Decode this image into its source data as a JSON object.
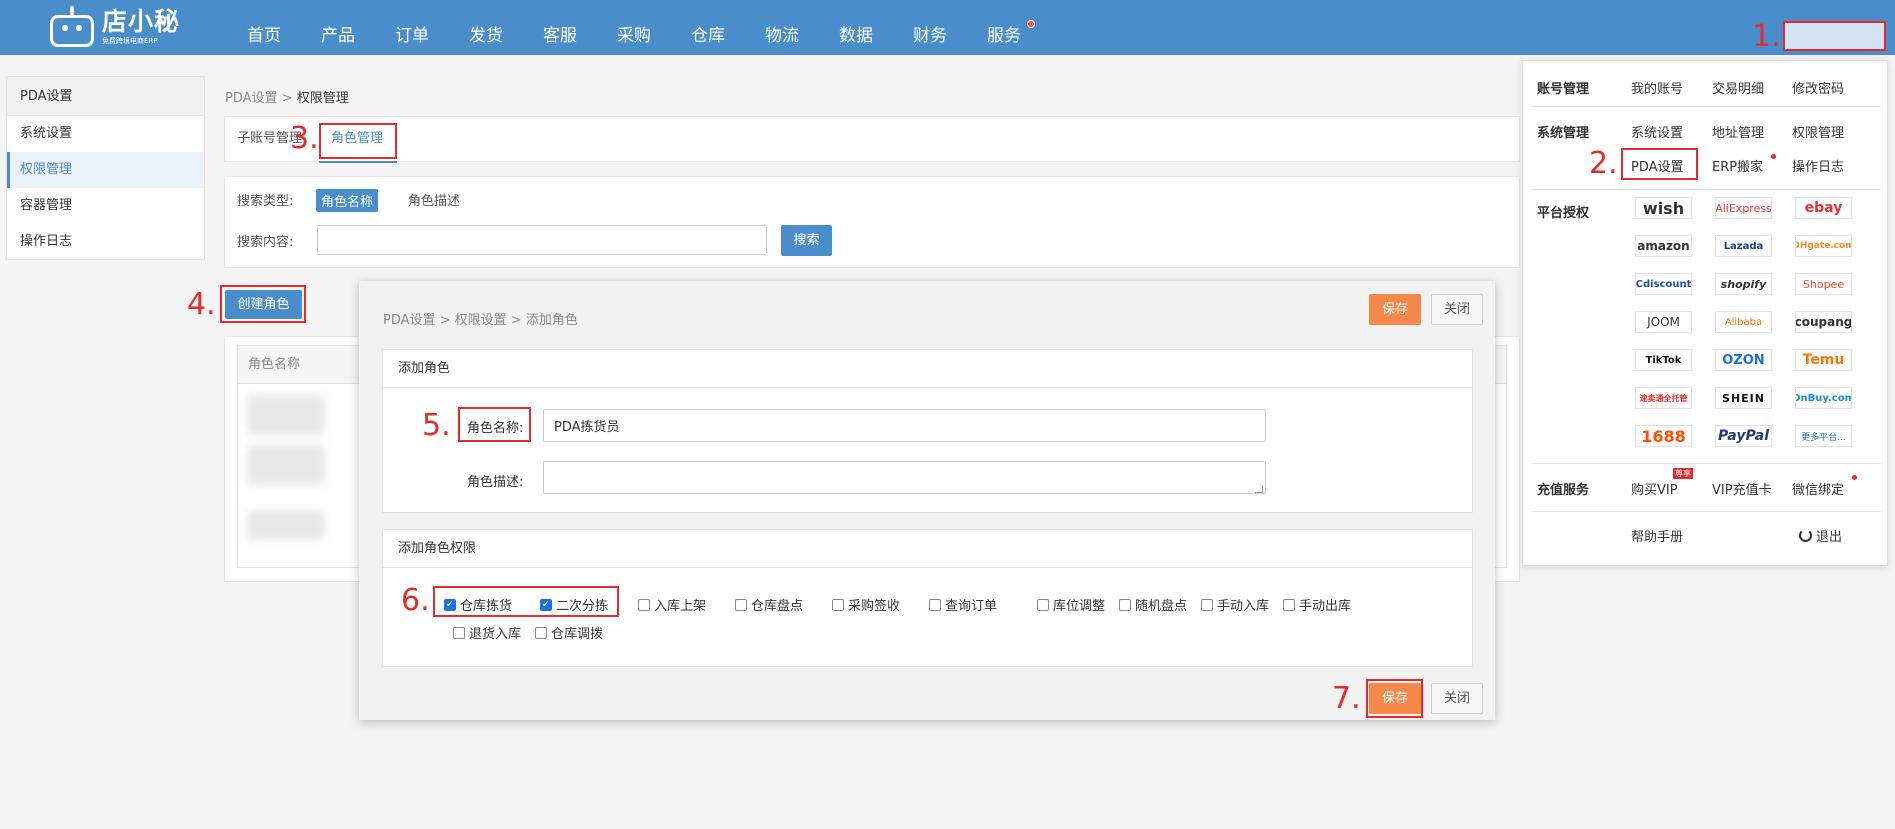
{
  "app": {
    "name": "店小秘",
    "subtitle": "免费跨境电商ERP"
  },
  "nav": {
    "items": [
      {
        "label": "首页"
      },
      {
        "label": "产品"
      },
      {
        "label": "订单"
      },
      {
        "label": "发货"
      },
      {
        "label": "客服"
      },
      {
        "label": "采购"
      },
      {
        "label": "仓库"
      },
      {
        "label": "物流"
      },
      {
        "label": "数据"
      },
      {
        "label": "财务"
      },
      {
        "label": "服务"
      }
    ]
  },
  "annotations": {
    "n1": "1.",
    "n2": "2.",
    "n3": "3.",
    "n4": "4.",
    "n5": "5.",
    "n6": "6.",
    "n7": "7."
  },
  "sidebar": {
    "title": "PDA设置",
    "items": [
      {
        "label": "系统设置"
      },
      {
        "label": "权限管理"
      },
      {
        "label": "容器管理"
      },
      {
        "label": "操作日志"
      }
    ]
  },
  "breadcrumb": {
    "parent": "PDA设置",
    "sep": ">",
    "current": "权限管理"
  },
  "tabs": [
    {
      "label": "子账号管理"
    },
    {
      "label": "角色管理"
    }
  ],
  "search": {
    "type_label": "搜索类型:",
    "types": [
      {
        "label": "角色名称"
      },
      {
        "label": "角色描述"
      }
    ],
    "content_label": "搜索内容:",
    "content_value": "",
    "button": "搜索"
  },
  "create_button": "创建角色",
  "table": {
    "col_name": "角色名称"
  },
  "modal": {
    "breadcrumb": "PDA设置 > 权限设置 > 添加角色",
    "save": "保存",
    "close": "关闭",
    "section_role": "添加角色",
    "name_label": "角色名称:",
    "name_value": "PDA拣货员",
    "desc_label": "角色描述:",
    "desc_value": "",
    "section_perm": "添加角色权限",
    "permissions": [
      {
        "label": "仓库拣货",
        "checked": true
      },
      {
        "label": "二次分拣",
        "checked": true
      },
      {
        "label": "入库上架",
        "checked": false
      },
      {
        "label": "仓库盘点",
        "checked": false
      },
      {
        "label": "采购签收",
        "checked": false
      },
      {
        "label": "查询订单",
        "checked": false
      },
      {
        "label": "库位调整",
        "checked": false
      },
      {
        "label": "随机盘点",
        "checked": false
      },
      {
        "label": "手动入库",
        "checked": false
      },
      {
        "label": "手动出库",
        "checked": false
      },
      {
        "label": "退货入库",
        "checked": false
      },
      {
        "label": "仓库调拨",
        "checked": false
      }
    ]
  },
  "dropdown": {
    "account": {
      "head": "账号管理",
      "items": [
        "我的账号",
        "交易明细",
        "修改密码"
      ]
    },
    "system": {
      "head": "系统管理",
      "items": [
        "系统设置",
        "地址管理",
        "权限管理",
        "PDA设置",
        "ERP搬家",
        "操作日志"
      ]
    },
    "platform": {
      "head": "平台授权",
      "items": [
        "wish",
        "AliExpress",
        "ebay",
        "amazon",
        "Lazada",
        "DHgate.com",
        "Cdiscount",
        "shopify",
        "Shopee",
        "JOOM",
        "Alibaba",
        "coupang",
        "TikTok",
        "OZON",
        "Temu",
        "速卖通全托管",
        "SHEIN",
        "OnBuy.com",
        "1688",
        "PayPal",
        "更多平台..."
      ]
    },
    "vip": {
      "head": "充值服务",
      "items": [
        "购买VIP",
        "VIP充值卡",
        "微信绑定"
      ],
      "badge": "尊享"
    },
    "footer": {
      "help": "帮助手册",
      "logout": "退出"
    }
  },
  "colors": {
    "nav": "#4a8dcb",
    "annotation": "#e52b2b",
    "save": "#f5894b"
  }
}
